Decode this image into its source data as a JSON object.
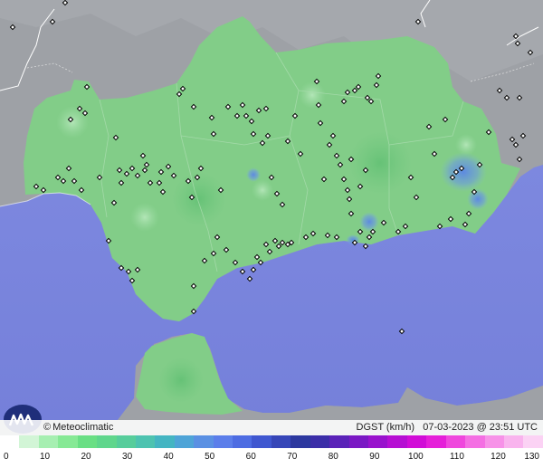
{
  "brand": {
    "copyright": "©",
    "name": "Meteoclimatic"
  },
  "variable_label": "DGST (km/h)",
  "timestamp": "07-03-2023 @ 23:51 UTC",
  "legend": {
    "ticks": [
      "0",
      "10",
      "20",
      "30",
      "40",
      "50",
      "60",
      "70",
      "80",
      "90",
      "100",
      "110",
      "120",
      "130"
    ],
    "colors": [
      "#ffffff",
      "#d2f5d6",
      "#a6efb1",
      "#86e995",
      "#69df84",
      "#5fd68c",
      "#56cd9b",
      "#4dc3b0",
      "#44b5c2",
      "#4ea4d7",
      "#5a90e3",
      "#5b7eea",
      "#4d6ce2",
      "#3f57d0",
      "#3646b8",
      "#2c389f",
      "#3b2ea8",
      "#5a22b8",
      "#7a18c4",
      "#9912cd",
      "#b60fd3",
      "#d10dd7",
      "#e51fd9",
      "#ef47dd",
      "#f46fe3",
      "#f792e8",
      "#f9b4ee",
      "#fbd2f4"
    ]
  },
  "colors": {
    "land_andalusia": "#82cd88",
    "land_other": "#9ea1a6",
    "sea": "#7b86de",
    "station": "#000000"
  }
}
